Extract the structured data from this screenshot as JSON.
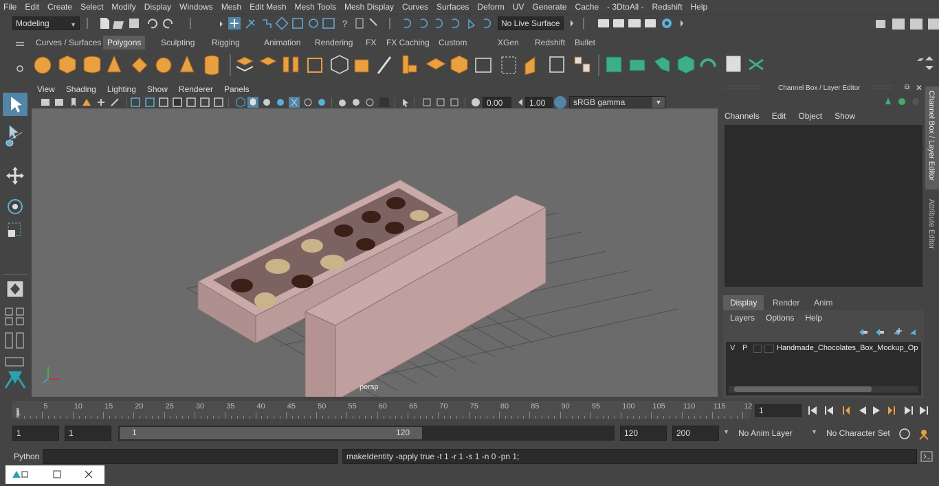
{
  "menubar": [
    "File",
    "Edit",
    "Create",
    "Select",
    "Modify",
    "Display",
    "Windows",
    "Mesh",
    "Edit Mesh",
    "Mesh Tools",
    "Mesh Display",
    "Curves",
    "Surfaces",
    "Deform",
    "UV",
    "Generate",
    "Cache",
    "- 3DtoAll -",
    "Redshift",
    "Help"
  ],
  "status": {
    "mode": "Modeling",
    "live_surface": "No Live Surface"
  },
  "shelf_tabs": [
    "Curves / Surfaces",
    "Polygons",
    "Sculpting",
    "Rigging",
    "Animation",
    "Rendering",
    "FX",
    "FX Caching",
    "Custom",
    "XGen",
    "Redshift",
    "Bullet"
  ],
  "shelf_active": "Polygons",
  "viewport": {
    "menu": [
      "View",
      "Shading",
      "Lighting",
      "Show",
      "Renderer",
      "Panels"
    ],
    "exposure": "0.00",
    "gamma": "1.00",
    "color_space": "sRGB gamma",
    "camera": "persp"
  },
  "channel_box": {
    "title": "Channel Box / Layer Editor",
    "menu": [
      "Channels",
      "Edit",
      "Object",
      "Show"
    ],
    "layer_tabs": [
      "Display",
      "Render",
      "Anim"
    ],
    "layer_tab_active": "Display",
    "layer_menu": [
      "Layers",
      "Options",
      "Help"
    ],
    "layer": {
      "v": "V",
      "p": "P",
      "name": "Handmade_Chocolates_Box_Mockup_Op"
    }
  },
  "side_tabs": [
    "Channel Box / Layer Editor",
    "Attribute Editor"
  ],
  "timeline": {
    "ticks": [
      "5",
      "10",
      "15",
      "20",
      "25",
      "30",
      "35",
      "40",
      "45",
      "50",
      "55",
      "60",
      "65",
      "70",
      "75",
      "80",
      "85",
      "90",
      "95",
      "100",
      "105",
      "110",
      "115",
      "12"
    ],
    "start": "1",
    "current_frame": "1"
  },
  "range": {
    "start": "1",
    "anim_start": "1",
    "range_start": "1",
    "range_end": "120",
    "end": "120",
    "anim_end": "200",
    "anim_layer": "No Anim Layer",
    "char_set": "No Character Set"
  },
  "command": {
    "lang": "Python",
    "output": "makeIdentity -apply true -t 1 -r 1 -s 1 -n 0 -pn 1;"
  },
  "colors": {
    "accent": "#5285a6",
    "panel": "#444444",
    "field": "#2b2b2b",
    "viewport": "#6b6b6b",
    "box": "#c4a6a4",
    "shelf_orange": "#e8a040",
    "shelf_green": "#3dae86"
  }
}
